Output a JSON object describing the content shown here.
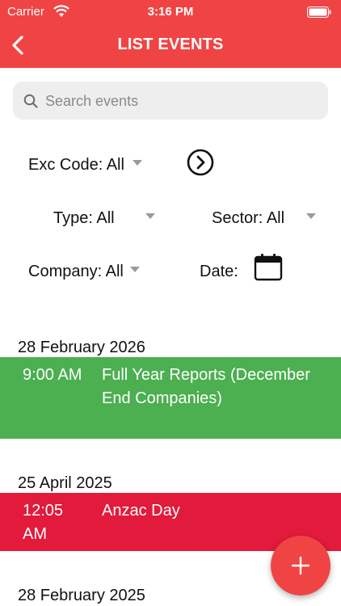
{
  "status_bar": {
    "carrier": "Carrier",
    "time": "3:16 PM"
  },
  "header": {
    "title": "LIST EVENTS",
    "back_icon": "chevron-left-icon"
  },
  "search": {
    "placeholder": "Search events",
    "value": ""
  },
  "filters": {
    "exc_code": "Exc Code: All",
    "type": "Type: All",
    "sector": "Sector: All",
    "company": "Company: All",
    "date_label": "Date:"
  },
  "event_groups": [
    {
      "date": "28 February 2026",
      "events": [
        {
          "time": "9:00 AM",
          "title": "Full Year Reports (December End Companies)",
          "color": "#4caf50"
        }
      ]
    },
    {
      "date": "25 April 2025",
      "events": [
        {
          "time": "12:05 AM",
          "title": "Anzac Day",
          "color": "#e21a3c"
        }
      ]
    },
    {
      "date": "28 February 2025",
      "events": []
    }
  ],
  "colors": {
    "accent": "#f04444",
    "green": "#4caf50",
    "red": "#e21a3c"
  }
}
